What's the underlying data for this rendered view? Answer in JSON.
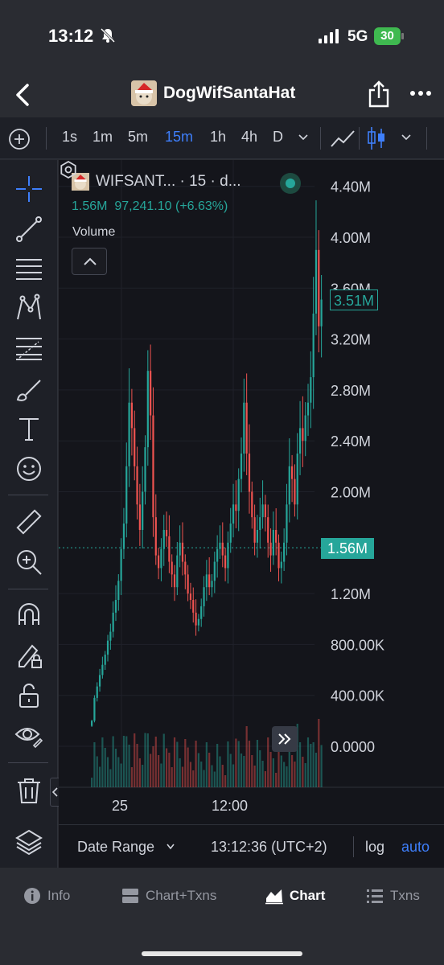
{
  "status_bar": {
    "time": "13:12",
    "network": "5G",
    "battery": "30"
  },
  "header": {
    "title": "DogWifSantaHat"
  },
  "toolbar": {
    "timeframes": [
      "1s",
      "1m",
      "5m",
      "15m",
      "1h",
      "4h",
      "D"
    ],
    "active_timeframe": "15m"
  },
  "legend": {
    "symbol": "WIFSANT... · 15 · d...",
    "ohlc_text": "1.56M  97,241.10 (+6.63%)",
    "volume_label": "Volume"
  },
  "price_axis": {
    "labels": [
      "4.40M",
      "4.00M",
      "3.60M",
      "3.20M",
      "2.80M",
      "2.40M",
      "2.00M",
      "1.20M",
      "800.00K",
      "400.00K",
      "0.0000"
    ],
    "current_price_tag": "3.51M",
    "last_price_tag": "1.56M"
  },
  "time_axis": {
    "labels": [
      "25",
      "12:00"
    ]
  },
  "chart_bottom": {
    "date_range": "Date Range",
    "clock": "13:12:36 (UTC+2)",
    "log": "log",
    "auto": "auto"
  },
  "tabs": [
    {
      "label": "Info",
      "icon": "info-icon"
    },
    {
      "label": "Chart+Txns",
      "icon": "chart-txns-icon"
    },
    {
      "label": "Chart",
      "icon": "area-chart-icon"
    },
    {
      "label": "Txns",
      "icon": "list-icon"
    }
  ],
  "active_tab": "Chart",
  "colors": {
    "up": "#26a69a",
    "down": "#ef5350",
    "accent": "#3e7ffb",
    "background": "#14151b"
  },
  "chart_data": {
    "type": "candlestick",
    "y_unit": "market cap",
    "ylim": [
      0,
      4400000
    ],
    "price_ticks": [
      0,
      400000,
      800000,
      1200000,
      1560000,
      2000000,
      2400000,
      2800000,
      3200000,
      3600000,
      4000000,
      4400000
    ],
    "close": [
      200000,
      380000,
      470000,
      560000,
      640000,
      720000,
      830000,
      900000,
      1050000,
      1150000,
      1300000,
      1550000,
      1750000,
      2200000,
      2700000,
      2500000,
      2200000,
      1900000,
      1700000,
      2000000,
      2350000,
      2950000,
      2600000,
      1800000,
      1500000,
      1400000,
      1550000,
      1700000,
      1650000,
      1450000,
      1350000,
      1250000,
      1500000,
      1600000,
      1450000,
      1350000,
      1200000,
      1150000,
      1050000,
      950000,
      1000000,
      1100000,
      1250000,
      1350000,
      1250000,
      1300000,
      1450000,
      1550000,
      1600000,
      1500000,
      1400000,
      1600000,
      1750000,
      1900000,
      1850000,
      2100000,
      2300000,
      2700000,
      2300000,
      2000000,
      1800000,
      1600000,
      1700000,
      1800000,
      1900000,
      1800000,
      1600000,
      1500000,
      1700000,
      1600000,
      1400000,
      1450000,
      1600000,
      1900000,
      2200000,
      2100000,
      1900000,
      2300000,
      2500000,
      2400000,
      2600000,
      2700000,
      2900000,
      3400000,
      3900000,
      3300000,
      3510000
    ]
  }
}
